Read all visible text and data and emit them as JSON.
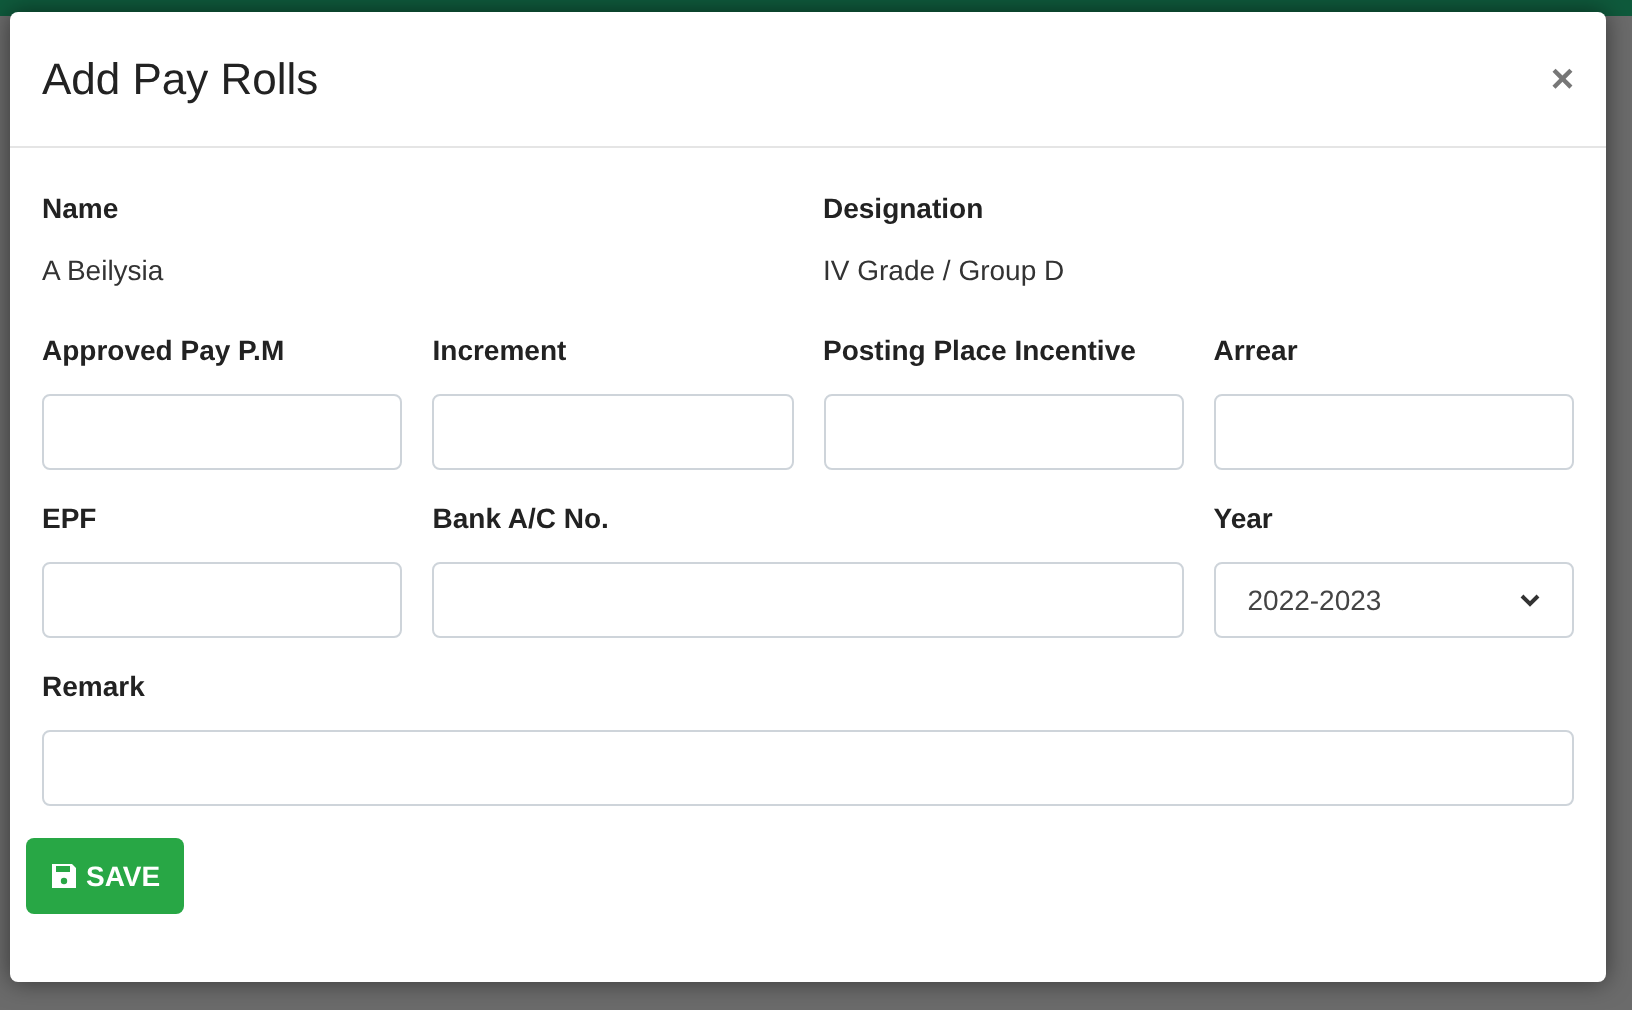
{
  "modal": {
    "title": "Add Pay Rolls",
    "close": "×"
  },
  "info": [
    {
      "label": "Name",
      "value": "A Beilysia"
    },
    {
      "label": "Designation",
      "value": "IV Grade / Group D"
    }
  ],
  "fields": [
    {
      "label": "Approved Pay P.M",
      "kind": "text"
    },
    {
      "label": "Increment",
      "kind": "text"
    },
    {
      "label": "Posting Place Incentive",
      "kind": "text"
    },
    {
      "label": "Arrear",
      "kind": "text"
    },
    {
      "label": "EPF",
      "kind": "text"
    },
    {
      "label": "Bank A/C No.",
      "kind": "text"
    },
    {
      "label": "Year",
      "kind": "select",
      "value": "2022-2023"
    },
    {
      "label": "Remark",
      "kind": "text"
    }
  ],
  "save_button": "SAVE"
}
